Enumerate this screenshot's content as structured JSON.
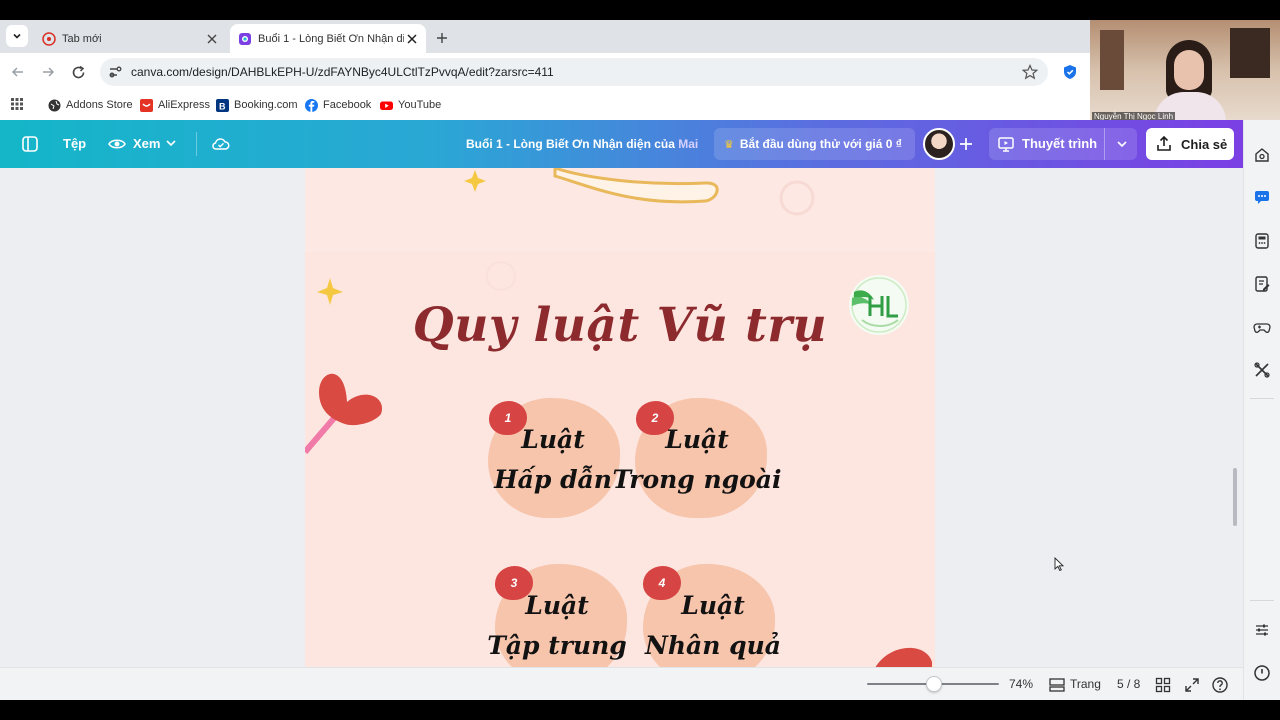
{
  "browser": {
    "tabs": [
      {
        "title": "Tab mới",
        "active": false
      },
      {
        "title": "Buổi 1 - Lòng Biết Ơn Nhận diệ",
        "active": true
      }
    ],
    "url": "canva.com/design/DAHBLkEPH-U/zdFAYNByc4ULCtlTzPvvqA/edit?zarsrc=411",
    "bookmarks": [
      "Addons Store",
      "AliExpress",
      "Booking.com",
      "Facebook",
      "YouTube"
    ]
  },
  "webcam": {
    "name": "Nguyễn Thị Ngọc Linh"
  },
  "canva": {
    "menu_file": "Tệp",
    "menu_view": "Xem",
    "design_title_prefix": "Buổi 1 - Lòng Biết Ơn Nhận diện của",
    "design_title_suffix": "Mai",
    "trial_label": "Bắt đầu dùng thử với giá 0 ₫",
    "present_label": "Thuyết trình",
    "share_label": "Chia sẻ",
    "accent_color": "#7b3fe4"
  },
  "slide": {
    "title": "Quy luật Vũ trụ",
    "laws": [
      {
        "number": "1",
        "line1": "Luật",
        "line2": "Hấp dẫn"
      },
      {
        "number": "2",
        "line1": "Luật",
        "line2": "Trong ngoài"
      },
      {
        "number": "3",
        "line1": "Luật",
        "line2": "Tập trung"
      },
      {
        "number": "4",
        "line1": "Luật",
        "line2": "Nhân quả"
      }
    ],
    "colors": {
      "title": "#8c2a2d",
      "background": "#fde6e0",
      "blob": "#f7c4ac",
      "badge": "#d64543"
    }
  },
  "status": {
    "zoom": "74%",
    "zoom_value": 0.74,
    "pages_label": "Trang",
    "page_indicator": "5 / 8"
  }
}
